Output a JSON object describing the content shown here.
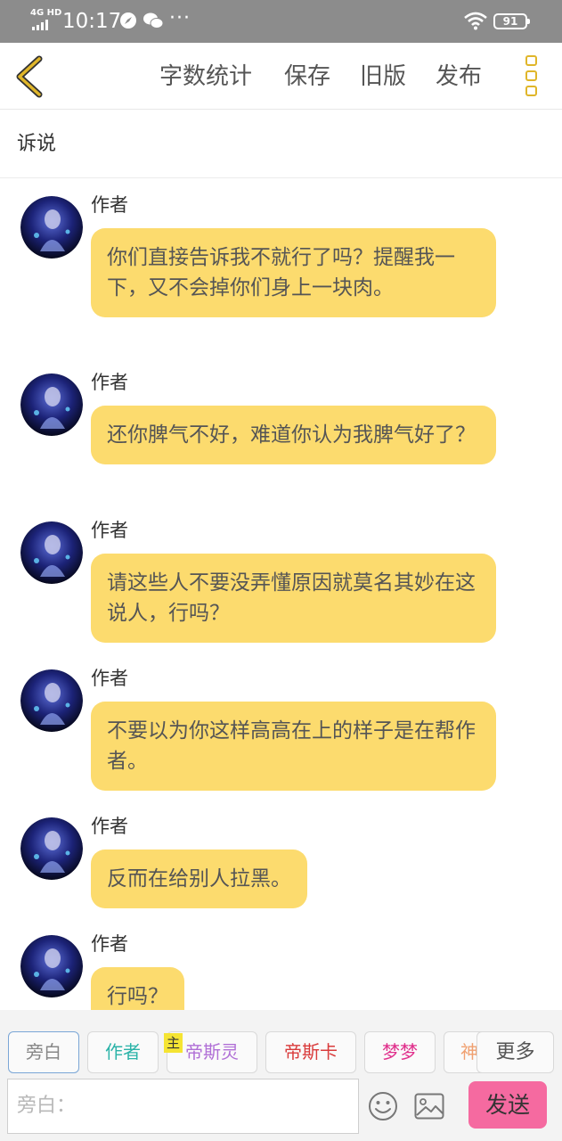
{
  "status_bar": {
    "network": "4G HD",
    "time": "10:17",
    "more": "···",
    "battery": "91"
  },
  "toolbar": {
    "word_count": "字数统计",
    "save": "保存",
    "old_version": "旧版",
    "publish": "发布"
  },
  "section": {
    "title": "诉说"
  },
  "messages": [
    {
      "name": "作者",
      "text": "你们直接告诉我不就行了吗？提醒我一下，又不会掉你们身上一块肉。"
    },
    {
      "name": "作者",
      "text": "还你脾气不好，难道你认为我脾气好了？"
    },
    {
      "name": "作者",
      "text": "请这些人不要没弄懂原因就莫名其妙在这说人，行吗？"
    },
    {
      "name": "作者",
      "text": "不要以为你这样高高在上的样子是在帮作者。"
    },
    {
      "name": "作者",
      "text": "反而在给别人拉黑。"
    },
    {
      "name": "作者",
      "text": "行吗？"
    }
  ],
  "roles": [
    {
      "label": "旁白",
      "color": "#888888",
      "active": true
    },
    {
      "label": "作者",
      "color": "#2bb3a8"
    },
    {
      "label": "帝斯灵",
      "color": "#b06fd6"
    },
    {
      "label": "帝斯卡",
      "color": "#d93b3b"
    },
    {
      "label": "梦梦",
      "color": "#e0308c"
    },
    {
      "label": "神",
      "color": "#f0a070"
    }
  ],
  "role_mark": "主",
  "more_roles": "更多",
  "input": {
    "placeholder": "旁白："
  },
  "send": "发送",
  "colors": {
    "bubble": "#fcdb6e",
    "accent": "#e0b62a",
    "send": "#f56aa0"
  }
}
